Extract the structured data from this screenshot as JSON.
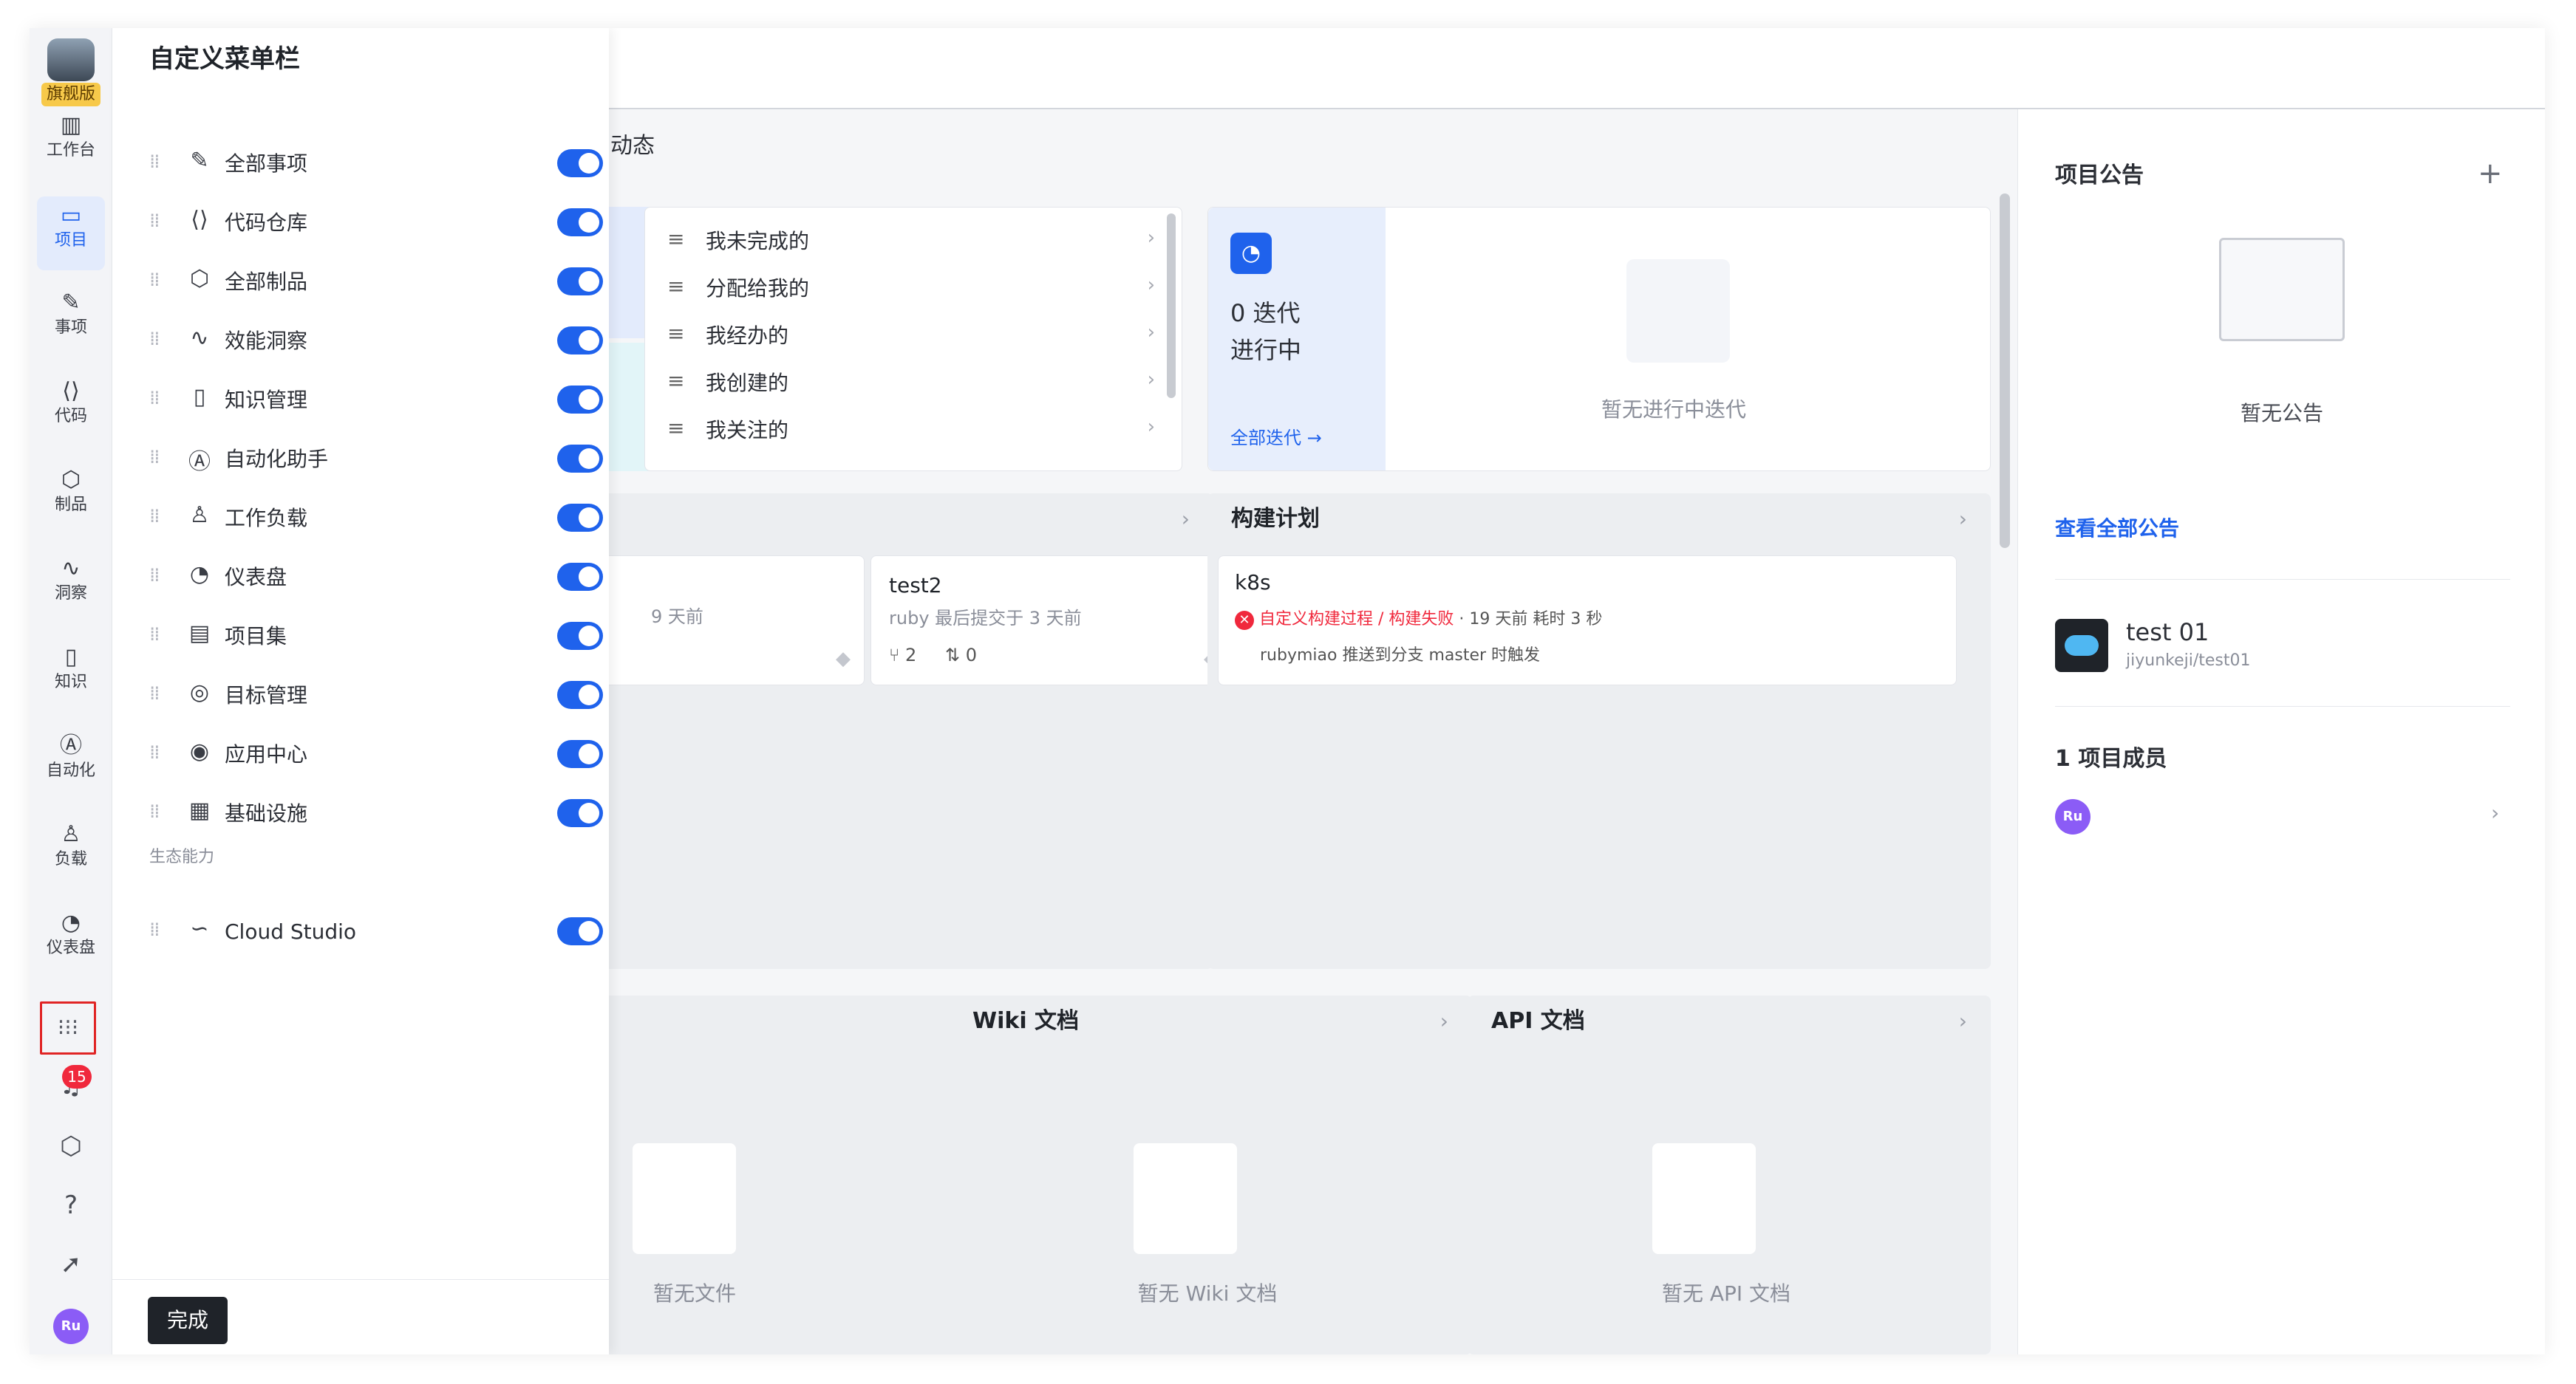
{
  "rail": {
    "brand_tag": "旗舰版",
    "items": [
      {
        "label": "工作台",
        "icon": "dashboard-icon"
      },
      {
        "label": "项目",
        "icon": "project-icon"
      },
      {
        "label": "事项",
        "icon": "issue-icon"
      },
      {
        "label": "代码",
        "icon": "code-icon"
      },
      {
        "label": "制品",
        "icon": "artifact-icon"
      },
      {
        "label": "洞察",
        "icon": "insight-icon"
      },
      {
        "label": "知识",
        "icon": "knowledge-icon"
      },
      {
        "label": "自动化",
        "icon": "automation-icon"
      },
      {
        "label": "负载",
        "icon": "workload-icon"
      },
      {
        "label": "仪表盘",
        "icon": "gauge-icon"
      }
    ],
    "notification_count": "15",
    "avatar": "Ru"
  },
  "menu": {
    "title": "自定义菜单栏",
    "items": [
      {
        "label": "全部事项",
        "enabled": true
      },
      {
        "label": "代码仓库",
        "enabled": true
      },
      {
        "label": "全部制品",
        "enabled": true
      },
      {
        "label": "效能洞察",
        "enabled": true
      },
      {
        "label": "知识管理",
        "enabled": true
      },
      {
        "label": "自动化助手",
        "enabled": true
      },
      {
        "label": "工作负载",
        "enabled": true
      },
      {
        "label": "仪表盘",
        "enabled": true
      },
      {
        "label": "项目集",
        "enabled": true
      },
      {
        "label": "目标管理",
        "enabled": true
      },
      {
        "label": "应用中心",
        "enabled": true
      },
      {
        "label": "基础设施",
        "enabled": true
      }
    ],
    "section": "生态能力",
    "eco_items": [
      {
        "label": "Cloud Studio",
        "enabled": true
      }
    ],
    "done_label": "完成"
  },
  "main": {
    "activity_title": "动态",
    "filters": [
      "我未完成的",
      "分配给我的",
      "我经办的",
      "我创建的",
      "我关注的"
    ],
    "iteration": {
      "count": "0 迭代",
      "status": "进行中",
      "link": "全部迭代 →",
      "empty": "暂无进行中迭代"
    },
    "repo": {
      "partial_time": "9 天前",
      "name": "test2",
      "meta": "ruby 最后提交于 3 天前",
      "branches": "2",
      "mrs": "0"
    },
    "build": {
      "title": "构建计划",
      "job": "k8s",
      "status": "自定义构建过程 / 构建失败",
      "time": "· 19 天前",
      "duration": "耗时 3 秒",
      "trigger": "rubymiao 推送到分支 master 时触发"
    },
    "files_empty": "暂无文件",
    "wiki": {
      "title": "Wiki 文档",
      "empty": "暂无 Wiki 文档"
    },
    "api": {
      "title": "API 文档",
      "empty": "暂无 API 文档"
    }
  },
  "side": {
    "announce_title": "项目公告",
    "announce_empty": "暂无公告",
    "view_all": "查看全部公告",
    "project_name": "test 01",
    "project_path": "jiyunkeji/test01",
    "members_title": "1 项目成员",
    "member_avatar": "Ru"
  }
}
